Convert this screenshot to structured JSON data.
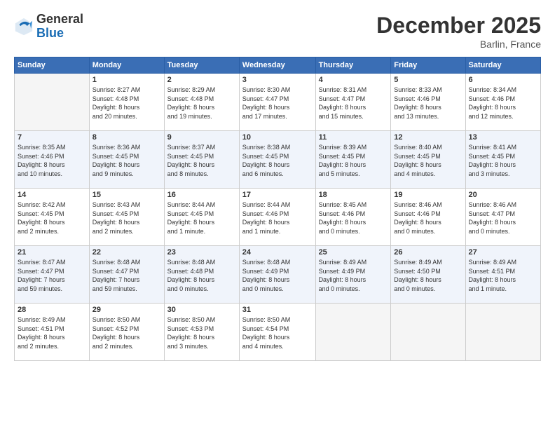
{
  "header": {
    "logo_line1": "General",
    "logo_line2": "Blue",
    "month": "December 2025",
    "location": "Barlin, France"
  },
  "days_of_week": [
    "Sunday",
    "Monday",
    "Tuesday",
    "Wednesday",
    "Thursday",
    "Friday",
    "Saturday"
  ],
  "weeks": [
    [
      {
        "day": "",
        "info": ""
      },
      {
        "day": "1",
        "info": "Sunrise: 8:27 AM\nSunset: 4:48 PM\nDaylight: 8 hours\nand 20 minutes."
      },
      {
        "day": "2",
        "info": "Sunrise: 8:29 AM\nSunset: 4:48 PM\nDaylight: 8 hours\nand 19 minutes."
      },
      {
        "day": "3",
        "info": "Sunrise: 8:30 AM\nSunset: 4:47 PM\nDaylight: 8 hours\nand 17 minutes."
      },
      {
        "day": "4",
        "info": "Sunrise: 8:31 AM\nSunset: 4:47 PM\nDaylight: 8 hours\nand 15 minutes."
      },
      {
        "day": "5",
        "info": "Sunrise: 8:33 AM\nSunset: 4:46 PM\nDaylight: 8 hours\nand 13 minutes."
      },
      {
        "day": "6",
        "info": "Sunrise: 8:34 AM\nSunset: 4:46 PM\nDaylight: 8 hours\nand 12 minutes."
      }
    ],
    [
      {
        "day": "7",
        "info": "Sunrise: 8:35 AM\nSunset: 4:46 PM\nDaylight: 8 hours\nand 10 minutes."
      },
      {
        "day": "8",
        "info": "Sunrise: 8:36 AM\nSunset: 4:45 PM\nDaylight: 8 hours\nand 9 minutes."
      },
      {
        "day": "9",
        "info": "Sunrise: 8:37 AM\nSunset: 4:45 PM\nDaylight: 8 hours\nand 8 minutes."
      },
      {
        "day": "10",
        "info": "Sunrise: 8:38 AM\nSunset: 4:45 PM\nDaylight: 8 hours\nand 6 minutes."
      },
      {
        "day": "11",
        "info": "Sunrise: 8:39 AM\nSunset: 4:45 PM\nDaylight: 8 hours\nand 5 minutes."
      },
      {
        "day": "12",
        "info": "Sunrise: 8:40 AM\nSunset: 4:45 PM\nDaylight: 8 hours\nand 4 minutes."
      },
      {
        "day": "13",
        "info": "Sunrise: 8:41 AM\nSunset: 4:45 PM\nDaylight: 8 hours\nand 3 minutes."
      }
    ],
    [
      {
        "day": "14",
        "info": "Sunrise: 8:42 AM\nSunset: 4:45 PM\nDaylight: 8 hours\nand 2 minutes."
      },
      {
        "day": "15",
        "info": "Sunrise: 8:43 AM\nSunset: 4:45 PM\nDaylight: 8 hours\nand 2 minutes."
      },
      {
        "day": "16",
        "info": "Sunrise: 8:44 AM\nSunset: 4:45 PM\nDaylight: 8 hours\nand 1 minute."
      },
      {
        "day": "17",
        "info": "Sunrise: 8:44 AM\nSunset: 4:46 PM\nDaylight: 8 hours\nand 1 minute."
      },
      {
        "day": "18",
        "info": "Sunrise: 8:45 AM\nSunset: 4:46 PM\nDaylight: 8 hours\nand 0 minutes."
      },
      {
        "day": "19",
        "info": "Sunrise: 8:46 AM\nSunset: 4:46 PM\nDaylight: 8 hours\nand 0 minutes."
      },
      {
        "day": "20",
        "info": "Sunrise: 8:46 AM\nSunset: 4:47 PM\nDaylight: 8 hours\nand 0 minutes."
      }
    ],
    [
      {
        "day": "21",
        "info": "Sunrise: 8:47 AM\nSunset: 4:47 PM\nDaylight: 7 hours\nand 59 minutes."
      },
      {
        "day": "22",
        "info": "Sunrise: 8:48 AM\nSunset: 4:47 PM\nDaylight: 7 hours\nand 59 minutes."
      },
      {
        "day": "23",
        "info": "Sunrise: 8:48 AM\nSunset: 4:48 PM\nDaylight: 8 hours\nand 0 minutes."
      },
      {
        "day": "24",
        "info": "Sunrise: 8:48 AM\nSunset: 4:49 PM\nDaylight: 8 hours\nand 0 minutes."
      },
      {
        "day": "25",
        "info": "Sunrise: 8:49 AM\nSunset: 4:49 PM\nDaylight: 8 hours\nand 0 minutes."
      },
      {
        "day": "26",
        "info": "Sunrise: 8:49 AM\nSunset: 4:50 PM\nDaylight: 8 hours\nand 0 minutes."
      },
      {
        "day": "27",
        "info": "Sunrise: 8:49 AM\nSunset: 4:51 PM\nDaylight: 8 hours\nand 1 minute."
      }
    ],
    [
      {
        "day": "28",
        "info": "Sunrise: 8:49 AM\nSunset: 4:51 PM\nDaylight: 8 hours\nand 2 minutes."
      },
      {
        "day": "29",
        "info": "Sunrise: 8:50 AM\nSunset: 4:52 PM\nDaylight: 8 hours\nand 2 minutes."
      },
      {
        "day": "30",
        "info": "Sunrise: 8:50 AM\nSunset: 4:53 PM\nDaylight: 8 hours\nand 3 minutes."
      },
      {
        "day": "31",
        "info": "Sunrise: 8:50 AM\nSunset: 4:54 PM\nDaylight: 8 hours\nand 4 minutes."
      },
      {
        "day": "",
        "info": ""
      },
      {
        "day": "",
        "info": ""
      },
      {
        "day": "",
        "info": ""
      }
    ]
  ]
}
